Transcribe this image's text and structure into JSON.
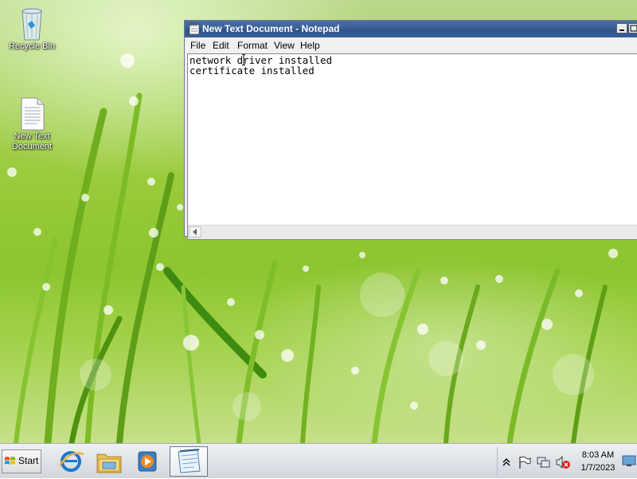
{
  "desktop": {
    "icons": [
      {
        "label": "Recycle Bin",
        "icon": "recycle-bin-icon"
      },
      {
        "label": "New Text Document",
        "icon": "text-document-icon"
      }
    ]
  },
  "notepad": {
    "title": "New Text Document - Notepad",
    "menu": [
      "File",
      "Edit",
      "Format",
      "View",
      "Help"
    ],
    "content": "network driver installed\ncertificate installed"
  },
  "taskbar": {
    "start_label": "Start",
    "pinned": [
      "internet-explorer-icon",
      "windows-explorer-icon",
      "media-player-icon",
      "notepad-icon"
    ],
    "tray_icons": [
      "show-hidden-icons-chevron",
      "action-center-flag-icon",
      "network-icon",
      "volume-muted-icon"
    ],
    "clock": {
      "time": "8:03 AM",
      "date": "1/7/2023"
    }
  },
  "colors": {
    "titlebar": "#3b5e98",
    "desktop_green": "#9acb3c",
    "taskbar": "#dfe3e8"
  }
}
